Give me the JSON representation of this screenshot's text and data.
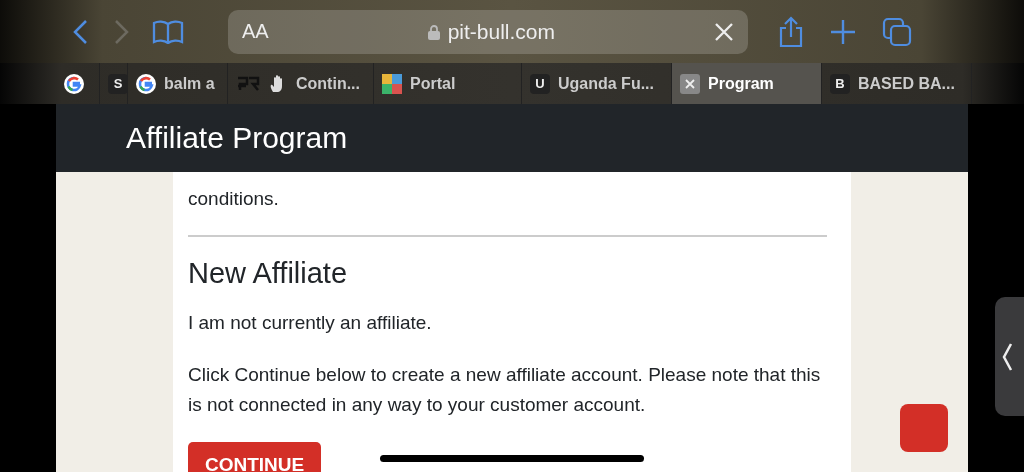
{
  "toolbar": {
    "text_size": "AA",
    "url": "pit-bull.com"
  },
  "tabs": [
    {
      "kind": "google",
      "selected": false
    },
    {
      "kind": "letter",
      "letter": "S",
      "selected": false
    },
    {
      "kind": "google",
      "label": "balm a",
      "selected": false
    },
    {
      "kind": "qr",
      "label": "Contin...",
      "selected": false
    },
    {
      "kind": "puzzle",
      "label": "Portal",
      "selected": false
    },
    {
      "kind": "letter",
      "letter": "U",
      "label": "Uganda Fu...",
      "selected": false
    },
    {
      "kind": "close",
      "label": "Program",
      "selected": true
    },
    {
      "kind": "letter",
      "letter": "B",
      "label": "BASED BA...",
      "selected": false
    }
  ],
  "header": {
    "title": "Affiliate Program"
  },
  "card": {
    "intro_tail": "conditions.",
    "heading": "New Affiliate",
    "status": "I am not currently an affiliate.",
    "note": "Click Continue below to create a new affiliate account. Please note that this is not connected in any way to your customer account.",
    "button": "CONTINUE"
  }
}
